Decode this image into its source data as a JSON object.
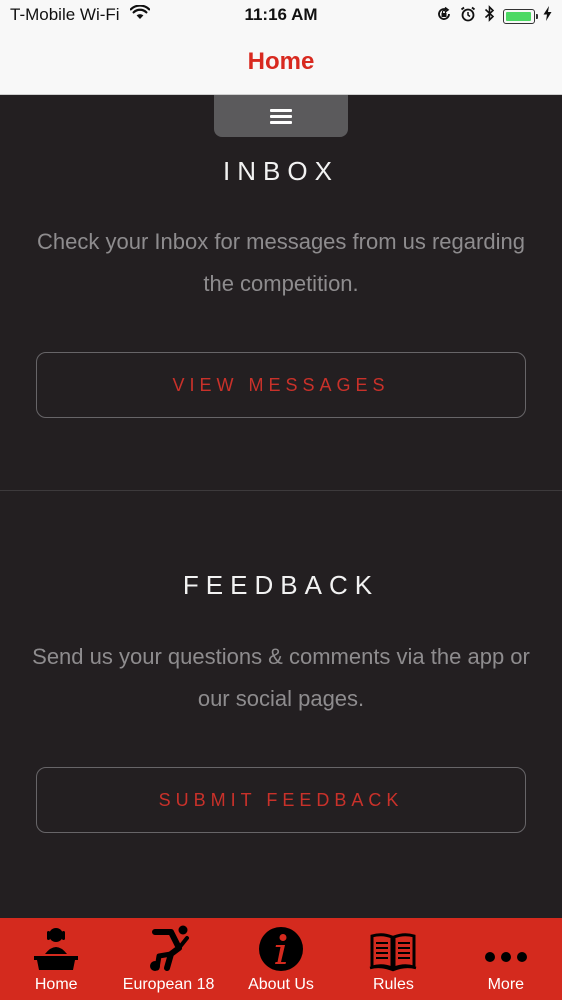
{
  "status_bar": {
    "carrier": "T-Mobile Wi-Fi",
    "time": "11:16 AM",
    "battery_level": 0.95
  },
  "nav": {
    "title": "Home"
  },
  "inbox": {
    "title": "INBOX",
    "text": "Check your Inbox for messages from us regarding the competition.",
    "button": "VIEW MESSAGES"
  },
  "feedback": {
    "title": "FEEDBACK",
    "text": "Send us your questions & comments via the app or our social pages.",
    "button": "SUBMIT FEEDBACK"
  },
  "tabs": [
    {
      "label": "Home",
      "icon": "home-icon"
    },
    {
      "label": "European 18",
      "icon": "athlete-icon"
    },
    {
      "label": "About Us",
      "icon": "info-icon"
    },
    {
      "label": "Rules",
      "icon": "book-icon"
    },
    {
      "label": "More",
      "icon": "more-icon"
    }
  ],
  "colors": {
    "accent": "#d8291f",
    "background": "#231f21",
    "tab_bar": "#d42a1e"
  }
}
